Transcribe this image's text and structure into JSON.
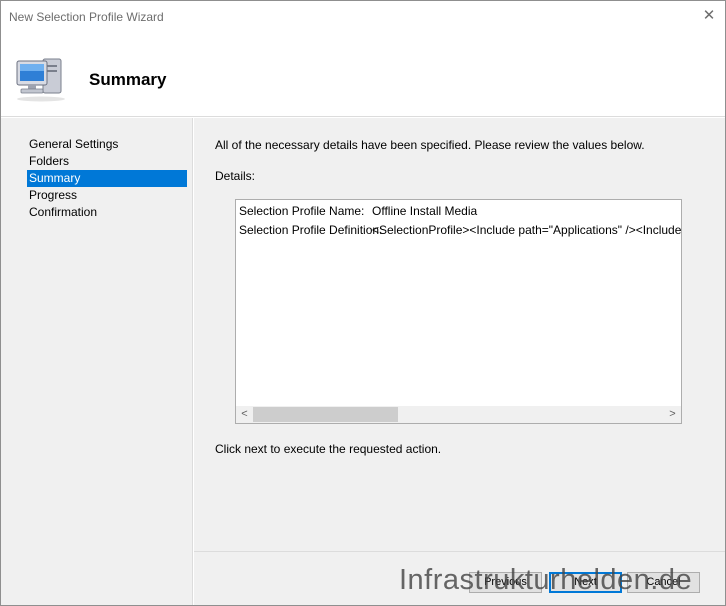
{
  "window": {
    "title": "New Selection Profile Wizard",
    "close_glyph": "✕"
  },
  "header": {
    "title": "Summary",
    "icon": "computer-icon"
  },
  "sidebar": {
    "steps": [
      {
        "label": "General Settings",
        "active": false
      },
      {
        "label": "Folders",
        "active": false
      },
      {
        "label": "Summary",
        "active": true
      },
      {
        "label": "Progress",
        "active": false
      },
      {
        "label": "Confirmation",
        "active": false
      }
    ]
  },
  "main": {
    "intro": "All of the necessary details have been specified.  Please review the values below.",
    "details_label": "Details:",
    "details": [
      {
        "key": "Selection Profile Name:",
        "value": "Offline Install Media"
      },
      {
        "key": "Selection Profile Definition:",
        "value": "<SelectionProfile><Include path=\"Applications\" /><Include path=\"Operating Systems\" /></SelectionProfile>"
      }
    ],
    "scroll_left": "<",
    "scroll_right": ">",
    "footer_text": "Click next to execute the requested action."
  },
  "buttons": {
    "previous": "Previous",
    "next": "Next",
    "cancel": "Cancel"
  },
  "watermark": "Infrastrukturhelden.de",
  "colors": {
    "accent": "#0078d7",
    "panel": "#f0f0f0",
    "border": "#adadad"
  }
}
